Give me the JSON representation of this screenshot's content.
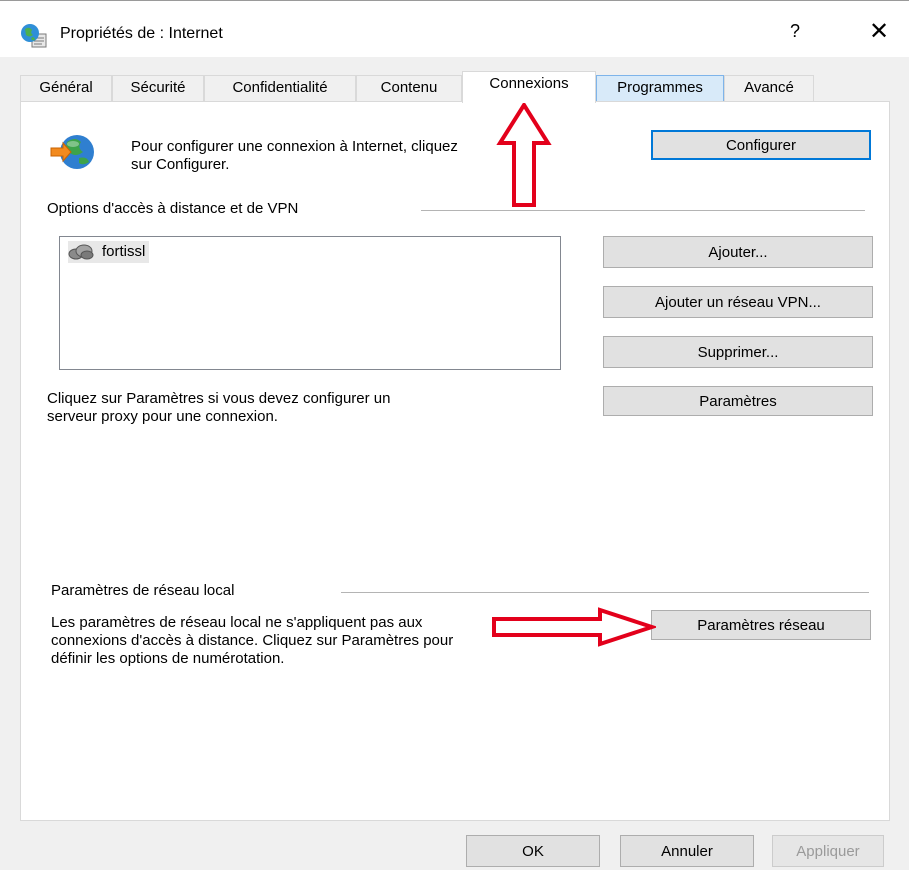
{
  "window": {
    "title": "Propriétés de : Internet",
    "help_glyph": "?",
    "close_glyph": "✕"
  },
  "tabs": [
    {
      "label": "Général",
      "active": false
    },
    {
      "label": "Sécurité",
      "active": false
    },
    {
      "label": "Confidentialité",
      "active": false
    },
    {
      "label": "Contenu",
      "active": false
    },
    {
      "label": "Connexions",
      "active": true
    },
    {
      "label": "Programmes",
      "active": false,
      "hover": true
    },
    {
      "label": "Avancé",
      "active": false
    }
  ],
  "setup": {
    "text_line1": "Pour configurer une connexion à Internet, cliquez",
    "text_line2": "sur Configurer.",
    "configure_button": "Configurer"
  },
  "dialup": {
    "group_label": "Options d'accès à distance et de VPN",
    "list_items": [
      "fortissl"
    ],
    "add_button": "Ajouter...",
    "add_vpn_button": "Ajouter un réseau VPN...",
    "remove_button": "Supprimer...",
    "settings_button": "Paramètres",
    "proxy_text_line1": "Cliquez sur Paramètres si vous devez configurer un",
    "proxy_text_line2": "serveur proxy pour une connexion."
  },
  "lan": {
    "group_label": "Paramètres de réseau local",
    "text_line1": "Les paramètres de réseau local ne s'appliquent pas aux",
    "text_line2": "connexions d'accès à distance. Cliquez sur Paramètres pour",
    "text_line3": "définir les options de numérotation.",
    "lan_settings_button": "Paramètres réseau"
  },
  "footer": {
    "ok_button": "OK",
    "cancel_button": "Annuler",
    "apply_button": "Appliquer",
    "apply_disabled": true
  },
  "colors": {
    "accent": "#0078d7",
    "annotation_red": "#e3001b",
    "tab_hover": "#d8eaf9"
  },
  "icons": {
    "title": "internet-options-globe-icon",
    "setup": "connection-wizard-globe-icon",
    "vpn": "vpn-connection-icon"
  }
}
